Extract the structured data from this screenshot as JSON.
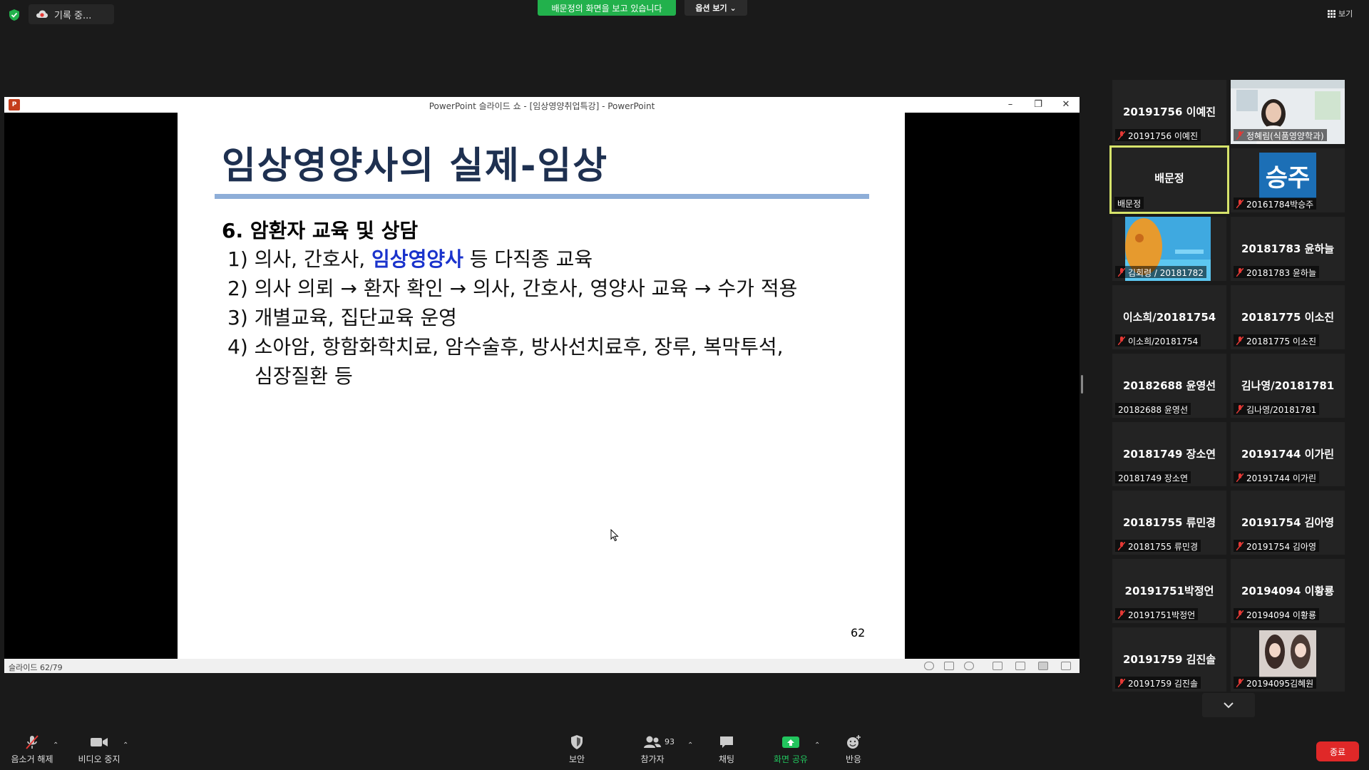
{
  "top_bar": {
    "recording_label": "기록 중...",
    "viewing_banner": "배문정의 화면을 보고 있습니다",
    "view_options": "옵션 보기 ⌄",
    "view_toggle": "보기"
  },
  "shared_window": {
    "title": "PowerPoint 슬라이드 쇼 - [임상영양취업특강] - PowerPoint",
    "logo": "P",
    "status_text": "슬라이드 62/79"
  },
  "slide": {
    "title": "임상영양사의 실제-임상",
    "heading": "6. 암환자 교육 및 상담",
    "line1_prefix": "1) 의사, 간호사, ",
    "line1_highlight": "임상영양사",
    "line1_suffix": " 등 다직종 교육",
    "line2": "2) 의사 의뢰 → 환자 확인 → 의사, 간호사, 영양사 교육 → 수가 적용",
    "line3": "3) 개별교육, 집단교육 운영",
    "line4": "4) 소아암, 항함화학치료, 암수술후, 방사선치료후, 장루, 복막투석,",
    "line5": "심장질환 등",
    "page_number": "62"
  },
  "gallery": {
    "tiles": [
      {
        "name": "20191756 이예진",
        "label": "20191756 이예진",
        "muted": true
      },
      {
        "name": "",
        "label": "정혜림(식품영양학과)",
        "muted": true
      },
      {
        "name": "배문정",
        "label": "배문정",
        "muted": false
      },
      {
        "name": "승주",
        "label": "20161784박승주",
        "muted": true
      },
      {
        "name": "",
        "label": "김회령 / 20181782",
        "muted": true
      },
      {
        "name": "20181783 윤하늘",
        "label": "20181783 윤하늘",
        "muted": true
      },
      {
        "name": "이소희/20181754",
        "label": "이소희/20181754",
        "muted": true
      },
      {
        "name": "20181775 이소진",
        "label": "20181775 이소진",
        "muted": true
      },
      {
        "name": "20182688 윤영선",
        "label": "20182688 윤영선",
        "muted": false
      },
      {
        "name": "김나영/20181781",
        "label": "김나영/20181781",
        "muted": true
      },
      {
        "name": "20181749 장소연",
        "label": "20181749 장소연",
        "muted": false
      },
      {
        "name": "20191744 이가린",
        "label": "20191744 이가린",
        "muted": true
      },
      {
        "name": "20181755 류민경",
        "label": "20181755 류민경",
        "muted": true
      },
      {
        "name": "20191754 김아영",
        "label": "20191754 김아영",
        "muted": true
      },
      {
        "name": "20191751박정언",
        "label": "20191751박정언",
        "muted": true
      },
      {
        "name": "20194094 이황룡",
        "label": "20194094 이황룡",
        "muted": true
      },
      {
        "name": "20191759 김진솔",
        "label": "20191759 김진솔",
        "muted": true
      },
      {
        "name": "",
        "label": "20194095김혜원",
        "muted": true
      }
    ]
  },
  "toolbar": {
    "unmute": "음소거 해제",
    "stop_video": "비디오 중지",
    "security": "보안",
    "participants": "참가자",
    "participant_count": "93",
    "chat": "채팅",
    "share_screen": "화면 공유",
    "reactions": "반응",
    "end": "종료"
  },
  "colors": {
    "banner_green": "#22b14c",
    "slide_title": "#1e3050",
    "highlight_blue": "#1a33cc",
    "end_red": "#e02828",
    "active_speaker": "#d6e36b"
  }
}
